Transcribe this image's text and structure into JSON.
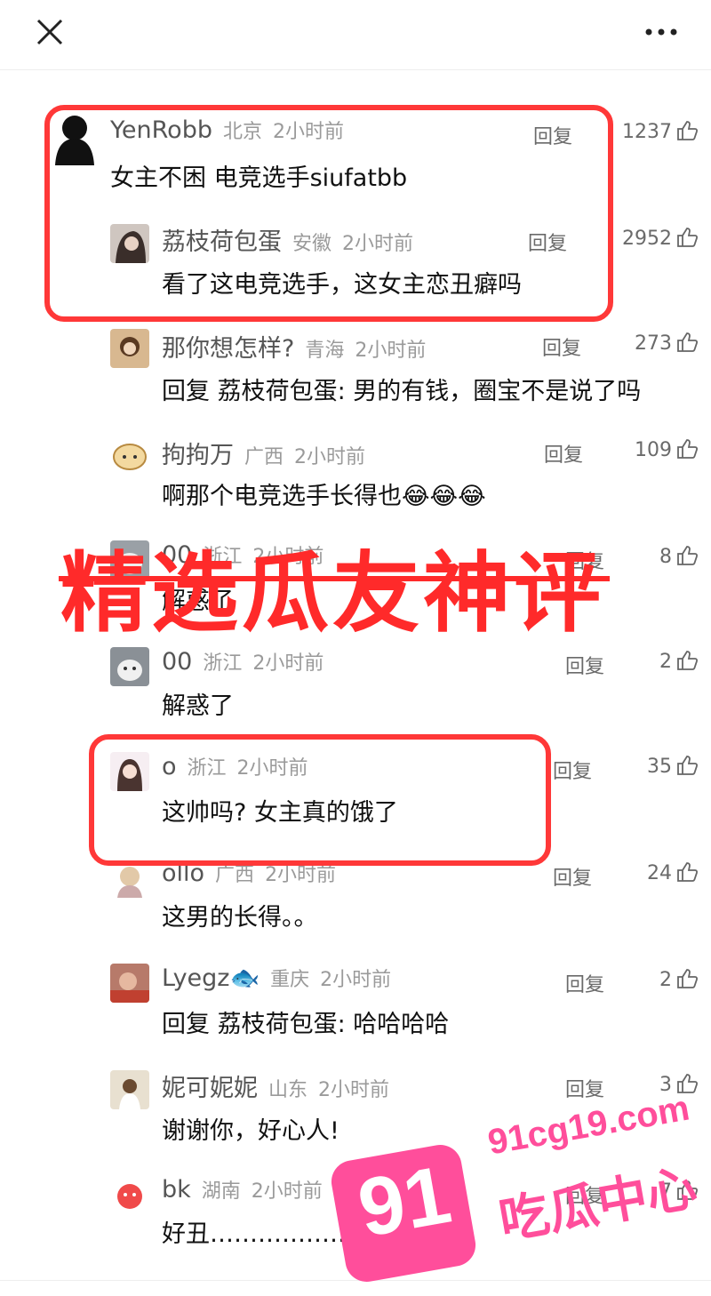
{
  "header": {
    "close_icon": "close-icon",
    "more_icon": "more-icon"
  },
  "overlay": {
    "title": "精选瓜友神评"
  },
  "watermark": {
    "number": "91",
    "url": "91cg19.com",
    "brand": "吃瓜中心"
  },
  "comments": [
    {
      "name": "YenRobb",
      "location": "北京",
      "time": "2小时前",
      "reply": "回复",
      "likes": "1237",
      "text": "女主不困 电竞选手siufatbb"
    },
    {
      "name": "荔枝荷包蛋",
      "location": "安徽",
      "time": "2小时前",
      "reply": "回复",
      "likes": "2952",
      "text": "看了这电竞选手，这女主恋丑癖吗"
    },
    {
      "name": "那你想怎样?",
      "location": "青海",
      "time": "2小时前",
      "reply": "回复",
      "likes": "273",
      "text": "回复 荔枝荷包蛋: 男的有钱，圈宝不是说了吗"
    },
    {
      "name": "拘拘万",
      "location": "广西",
      "time": "2小时前",
      "reply": "回复",
      "likes": "109",
      "text": "啊那个电竞选手长得也😂😂😂"
    },
    {
      "name": "00",
      "location": "浙江",
      "time": "2小时前",
      "reply": "回复",
      "likes": "8",
      "text": "解惑了"
    },
    {
      "name": "00",
      "location": "浙江",
      "time": "2小时前",
      "reply": "回复",
      "likes": "2",
      "text": "解惑了"
    },
    {
      "name": "o",
      "location": "浙江",
      "time": "2小时前",
      "reply": "回复",
      "likes": "35",
      "text": "这帅吗? 女主真的饿了"
    },
    {
      "name": "ollo",
      "location": "广西",
      "time": "2小时前",
      "reply": "回复",
      "likes": "24",
      "text": "这男的长得。。"
    },
    {
      "name": "Lyegz🐟",
      "location": "重庆",
      "time": "2小时前",
      "reply": "回复",
      "likes": "2",
      "text": "回复 荔枝荷包蛋: 哈哈哈哈"
    },
    {
      "name": "妮可妮妮",
      "location": "山东",
      "time": "2小时前",
      "reply": "回复",
      "likes": "3",
      "text": "谢谢你，好心人!"
    },
    {
      "name": "bk",
      "location": "湖南",
      "time": "2小时前",
      "reply": "回复",
      "likes": "7",
      "text": "好丑………………"
    }
  ],
  "colors": {
    "highlight": "#ff3838",
    "watermark": "#ff4e9b"
  }
}
